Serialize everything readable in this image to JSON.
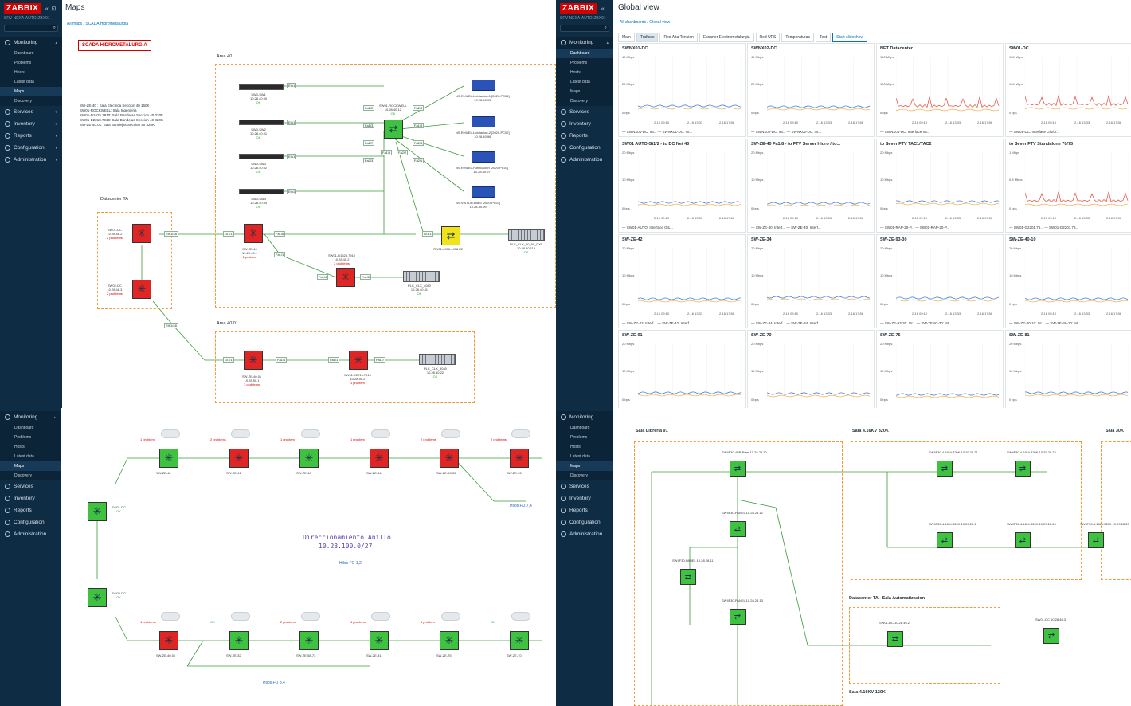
{
  "brand": {
    "logo": "ZABBIX",
    "server": "SRV-NEXA-AUTO-ZBX01"
  },
  "menu": {
    "monitoring": "Monitoring",
    "sub": [
      "Dashboard",
      "Problems",
      "Hosts",
      "Latest data",
      "Maps",
      "Discovery"
    ],
    "services": "Services",
    "inventory": "Inventory",
    "reports": "Reports",
    "configuration": "Configuration",
    "administration": "Administration"
  },
  "maps_view": {
    "title": "Maps",
    "crumbs": [
      "All maps",
      "SCADA Hidrometalurgia"
    ],
    "map_title": "SCADA HIDROMETALURGIA",
    "notes": [
      "SW-ZE-40 : Sala Electrica Seccion 40 160K",
      "SW01-ROCKWELL: Sala Ingenieria",
      "SW01-D1625.7910: Sala Bandejas Seccion 40 320K",
      "SW01-E2210.7910: Sala Bandejas Seccion 40 320K",
      "SW-ZE-40.01: Sala Bandejas Seccion 40 320K"
    ],
    "area40": "Area 40",
    "area4001": "Area 40.01",
    "datacenter": "Datacenter TA",
    "hosts": [
      {
        "name": "SW01-DC",
        "ip": "10.28.46.2",
        "status": "2 problems"
      },
      {
        "name": "SW02-DC",
        "ip": "10.28.46.3",
        "status": "2 problems"
      },
      {
        "name": "SW-ZE-40",
        "ip": "10.28.40.1",
        "status": "1 problem"
      },
      {
        "name": "SW01-D1625.7910",
        "ip": "10.28.40.2",
        "status": "2 problems"
      },
      {
        "name": "SW01-ROCKWELL",
        "ip": "10.28.40.12",
        "status": "OK"
      },
      {
        "name": "SW01-6906.4408.E2",
        "ip": "",
        "status": ""
      },
      {
        "name": "PLC_CLX_4080",
        "ip": "10.28.40.31",
        "status": "OK"
      },
      {
        "name": "PLC_CLX_40_50_DX5",
        "ip": "10.28.40.115",
        "status": "OK"
      },
      {
        "name": "SW-ZE-40.01",
        "ip": "10.28.50.1",
        "status": "3 problems"
      },
      {
        "name": "SW01-E2210.7910",
        "ip": "10.28.50.2",
        "status": "1 problem"
      },
      {
        "name": "PLC_CLX_5040",
        "ip": "10.28.50.22",
        "status": "OK"
      }
    ],
    "servers": [
      {
        "name": "SW0-SW1",
        "ip": "10.28.40.90",
        "status": "OK"
      },
      {
        "name": "SW0-SW2",
        "ip": "10.28.40.91",
        "status": "OK"
      },
      {
        "name": "SW0-SW3",
        "ip": "10.28.40.92",
        "status": "OK"
      },
      {
        "name": "SW0-SW4",
        "ip": "10.28.40.94",
        "status": "OK"
      }
    ],
    "routers": [
      {
        "name": "NS-ReWEL-Lixiviacion-1 [2020-PC01]",
        "ip": "10.28.40.95"
      },
      {
        "name": "NS-ReWEL-Lixiviacion-2 [2020-PC02]",
        "ip": "10.28.40.96"
      },
      {
        "name": "NS-ReWEL-Purificacion [2020-PC01]",
        "ip": "10.28.40.97"
      },
      {
        "name": "NS-VISTOR-Hidro [2020-PC01]",
        "ip": "10.28.40.99"
      }
    ],
    "ports": {
      "eth1": "Eth1",
      "eth1_48": "Eth1/48",
      "gi1_1": "Gi1/1",
      "fa1_1": "Fa1/1",
      "fa1_2": "Fa1/2",
      "fa1_3": "Fa1/3",
      "fa1_4": "Fa1/4",
      "fa1_5": "Fa1/5",
      "fa1_6": "Fa1/6",
      "fa1_7": "Fa1/7",
      "fa2_1": "Fa2/1",
      "fa2_2": "Fa2/2",
      "fa2_3": "Fa2/3",
      "fa2_4": "Fa2/4",
      "fa2_6": "Fa2/6"
    }
  },
  "global_view": {
    "title": "Global view",
    "crumbs": [
      "All dashboards",
      "Global view"
    ],
    "tabs": [
      "Main",
      "Traficos",
      "Red Alta Tension",
      "Escaner Electrometalurgia",
      "Red UPS",
      "Temperaturas",
      "Test",
      "Start slideshow"
    ],
    "widgets": [
      {
        "title": "SWNX01-DC",
        "ymax": "40 Mbps",
        "ymid": "20 Mbps",
        "legend": "— SWNX01-DC: Int...   — SWNX01-DC: Int..."
      },
      {
        "title": "SWNX02-DC",
        "ymax": "40 Mbps",
        "ymid": "20 Mbps",
        "legend": "— SWNX02-DC: Int...   — SWNX02-DC: Int..."
      },
      {
        "title": "NET Datacenter",
        "ymax": "150 Mbps",
        "ymid": "100 Mbps",
        "legend": "— SWNX01-DC: Interface Va..."
      },
      {
        "title": "SW01-DC",
        "ymax": "150 Mbps",
        "ymid": "100 Mbps",
        "legend": "— SW01-DC: Interface Gi1/0/..."
      },
      {
        "title": "SW01 AUTO Gi1/2 - to DC Net 40",
        "ymax": "20 Mbps",
        "ymid": "10 Mbps",
        "legend": "— SW01-AUTO: Interface Gi1..."
      },
      {
        "title": "SW-ZE-40 Fa1/8 - to FTV Server Hidro / to...",
        "ymax": "20 Mbps",
        "ymid": "10 Mbps",
        "legend": "— SW-ZE-40: Interf...   — SW-ZE-40: Interf..."
      },
      {
        "title": "to Sever FTV TAC1/TAC2",
        "ymax": "20 Mbps",
        "ymid": "10 Mbps",
        "legend": "— SW01-RAP-20-P...   — SW01-RAP-20-P..."
      },
      {
        "title": "to Sever FTV Standalone 70/75",
        "ymax": "1 Mbps",
        "ymid": "0.8 Mbps",
        "legend": "— SW01-G2201.76...   — SW01-G2201.76..."
      },
      {
        "title": "SW-ZE-42",
        "ymax": "20 Mbps",
        "ymid": "10 Mbps",
        "legend": "— SW-ZE-42: Interf...   — SW-ZE-42: Interf..."
      },
      {
        "title": "SW-ZE-34",
        "ymax": "20 Mbps",
        "ymid": "10 Mbps",
        "legend": "— SW-ZE-34: Interf...   — SW-ZE-34: Interf..."
      },
      {
        "title": "SW-ZE-93-30",
        "ymax": "20 Mbps",
        "ymid": "10 Mbps",
        "legend": "— SW-ZE-93-30: Int...   — SW-ZE-93-30: Int..."
      },
      {
        "title": "SW-ZE-40-10",
        "ymax": "20 Mbps",
        "ymid": "10 Mbps",
        "legend": "— SW-ZE-40-10: Int...   — SW-ZE-40-10: Int..."
      },
      {
        "title": "SW-ZE-91",
        "ymax": "20 Mbps",
        "ymid": "10 Mbps",
        "legend": ""
      },
      {
        "title": "SW-ZE-70",
        "ymax": "20 Mbps",
        "ymid": "10 Mbps",
        "legend": ""
      },
      {
        "title": "SW-ZE-75",
        "ymax": "20 Mbps",
        "ymid": "10 Mbps",
        "legend": ""
      },
      {
        "title": "SW-ZE-81",
        "ymax": "20 Mbps",
        "ymid": "10 Mbps",
        "legend": ""
      }
    ],
    "time_labels": [
      "2-16 09:10",
      "2-16 13:33",
      "2-16 17:56"
    ],
    "zero": "0 bps"
  },
  "ring_view": {
    "title": "Direccionamiento Anillo",
    "subnet": "10.28.100.0/27",
    "hilos12": "Hilos FO 1,2",
    "hilos34": "Hilos FO 3,4",
    "hilos74": "Hilos FO 7,4",
    "top": [
      {
        "name": "SW-ZE-40",
        "status": "1 problem",
        "color": "green"
      },
      {
        "name": "SW-ZE-41",
        "status": "2 problems",
        "color": "red"
      },
      {
        "name": "SW-ZE-40",
        "status": "1 problem",
        "color": "green"
      },
      {
        "name": "SW-ZE-44",
        "status": "1 problem",
        "color": "red"
      },
      {
        "name": "SW-ZE-93-30",
        "status": "2 problems",
        "color": "red"
      },
      {
        "name": "SW-ZE-93",
        "status": "2 problems",
        "color": "red"
      }
    ],
    "bottom": [
      {
        "name": "SW-ZE-40.01",
        "status": "4 problems",
        "color": "red"
      },
      {
        "name": "SW-ZE-32",
        "status": "OK",
        "color": "green"
      },
      {
        "name": "SW-ZE-58-73",
        "status": "2 problems",
        "color": "green"
      },
      {
        "name": "SW-ZE-81",
        "status": "4 problems",
        "color": "green"
      },
      {
        "name": "SW-ZE-75",
        "status": "1 problem",
        "color": "green"
      },
      {
        "name": "SW-ZE-70",
        "status": "OK",
        "color": "green"
      }
    ],
    "dc": [
      {
        "name": "SW01-DC",
        "status": "OK"
      },
      {
        "name": "SW02-DC",
        "status": "OK"
      }
    ]
  },
  "sala_view": {
    "sala91": "Sala Libreria 91",
    "sala320": "Sala 4.16KV 320K",
    "sala30": "Sala 30K",
    "dc_auto": "Datacenter TA - Sala Automatizacion",
    "sala120": "Sala 4.16KV 120K",
    "hosts": [
      {
        "name": "SW4F30-4BB-Rear",
        "ip": "10.28.28.10"
      },
      {
        "name": "SW4F30-4.16kV.320K",
        "ip": "10.29.28.21"
      },
      {
        "name": "SW4F30-4.16kV.320K",
        "ip": "10.29.28.22"
      },
      {
        "name": "SW4F30-4.16kV.320K",
        "ip": "10.29.28.23"
      },
      {
        "name": "SW4F30-4.16kV.320K",
        "ip": "10.29.28.1"
      },
      {
        "name": "SW4F30-4.16kV.320K",
        "ip": "10.29.28.24"
      },
      {
        "name": "SW4F30-PANEL",
        "ip": "10.28.28.12"
      },
      {
        "name": "SW4F30-PANEL",
        "ip": "10.28.28.11"
      },
      {
        "name": "SW4F30-PANEL",
        "ip": "10.28.28.13"
      },
      {
        "name": "SW01-DC",
        "ip": "10.28.46.2"
      },
      {
        "name": "SW01-DC",
        "ip": "10.28.46.3"
      }
    ],
    "ports": {
      "fa2_1": "Fa2/1",
      "fa2_2": "Fa2/2",
      "fa2_6": "Fa2/6",
      "fa1_2": "Fa1/2",
      "port6": "Port6",
      "port7": "Port7",
      "port8": "Port8",
      "gi1_0_52": "Gi1/0/52",
      "gi1_0_51": "Gi1/0/51",
      "eth1_46": "Eth1/46"
    }
  }
}
